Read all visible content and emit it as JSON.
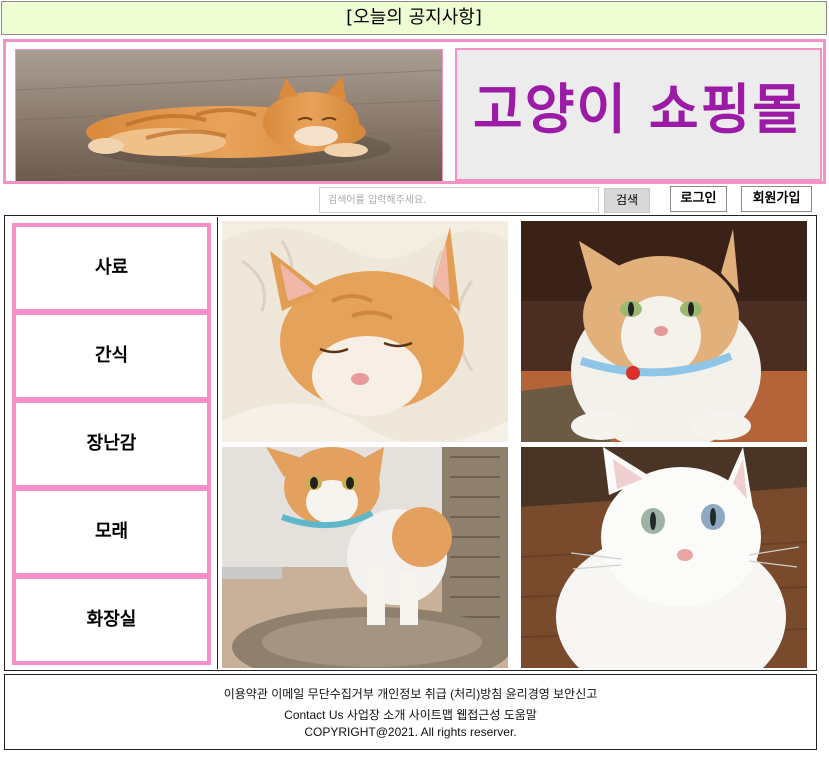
{
  "notice": {
    "text": "[오늘의 공지사항]"
  },
  "header": {
    "logo_text": "고양이 쇼핑몰"
  },
  "search": {
    "placeholder": "검색어를 입력해주세요.",
    "button_label": "검색"
  },
  "account": {
    "login_label": "로그인",
    "signup_label": "회원가입"
  },
  "nav": {
    "items": [
      {
        "label": "사료"
      },
      {
        "label": "간식"
      },
      {
        "label": "장난감"
      },
      {
        "label": "모래"
      },
      {
        "label": "화장실"
      }
    ]
  },
  "footer": {
    "line1": "이용약관 이메일 무단수집거부 개인정보 취급 (처리)방침 윤리경영 보안신고",
    "line2": "Contact Us 사업장 소개 사이트맵 웹접근성 도움말",
    "line3": "COPYRIGHT@2021. All rights reserver."
  },
  "colors": {
    "notice_bg": "#eefdd2",
    "pink_border": "#f591c5",
    "logo_text": "#9b1aa6",
    "logo_bg": "#ececec"
  }
}
